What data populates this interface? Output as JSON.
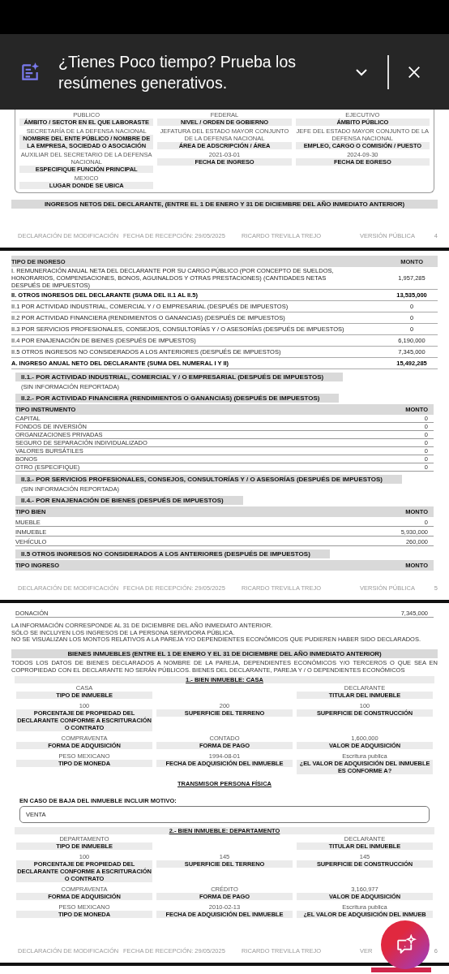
{
  "banner": {
    "text": "¿Tienes Poco tiempo? Prueba los resúmenes generativos."
  },
  "page_4": {
    "fields": [
      {
        "value": "PUBLICO",
        "label": "ÁMBITO / SECTOR EN EL QUE LABORASTE"
      },
      {
        "value": "FEDERAL",
        "label": "NIVEL / ORDEN DE GOBIERNO"
      },
      {
        "value": "EJECUTIVO",
        "label": "ÁMBITO PÚBLICO"
      },
      {
        "value": "SECRETARÍA DE LA DEFENSA NACIONAL",
        "label": "NOMBRE DEL ENTE PÚBLICO / NOMBRE DE LA EMPRESA, SOCIEDAD O ASOCIACIÓN"
      },
      {
        "value": "JEFATURA DEL ESTADO MAYOR CONJUNTO DE LA DEFENSA NACIONAL",
        "label": "ÁREA DE ADSCRIPCIÓN / ÁREA"
      },
      {
        "value": "JEFE DEL ESTADO MAYOR CONJUNTO DE LA DEFENSA NACIONAL",
        "label": "EMPLEO, CARGO O COMISIÓN / PUESTO"
      },
      {
        "value": "AUXILIAR DEL SECRETARIO DE LA DEFENSA NACIONAL",
        "label": "ESPECIFIQUE FUNCIÓN PRINCIPAL"
      },
      {
        "value": "2021-03-01",
        "label": "FECHA DE INGRESO"
      },
      {
        "value": "2024-09-30",
        "label": "FECHA DE EGRESO"
      },
      {
        "value": "MEXICO",
        "label": "LUGAR DONDE SE UBICA"
      }
    ],
    "heading": "INGRESOS NETOS DEL DECLARANTE, (ENTRE EL 1 DE ENERO Y 31 DE DICIEMBRE DEL AÑO INMEDIATO ANTERIOR)",
    "footer": {
      "doc_type": "DECLARACIÓN DE MODIFICACIÓN",
      "received": "FECHA DE RECEPCIÓN: 29/05/2025",
      "name": "RICARDO TREVILLA TREJO",
      "version": "VERSIÓN PÚBLICA",
      "page": "4"
    }
  },
  "page_5": {
    "income_table": {
      "columns": [
        "TIPO DE INGRESO",
        "MONTO"
      ],
      "rows": [
        {
          "label": "I. REMUNERACIÓN ANUAL NETA DEL DECLARANTE POR SU CARGO PÚBLICO (POR CONCEPTO DE SUELDOS, HONORARIOS, COMPENSACIONES, BONOS, AGUINALDOS Y OTRAS PRESTACIONES) (CANTIDADES NETAS DESPUÉS DE IMPUESTOS)",
          "amount": "1,957,285",
          "bold": false
        },
        {
          "label": "II. OTROS INGRESOS DEL DECLARANTE (SUMA DEL II.1 AL II.5)",
          "amount": "13,535,000",
          "bold": true
        },
        {
          "label": "II.1 POR ACTIVIDAD INDUSTRIAL, COMERCIAL Y / O EMPRESARIAL (DESPUÉS DE IMPUESTOS)",
          "amount": "0",
          "bold": false
        },
        {
          "label": "II.2 POR ACTIVIDAD FINANCIERA (RENDIMIENTOS O GANANCIAS) (DESPUÉS DE IMPUESTOS)",
          "amount": "0",
          "bold": false
        },
        {
          "label": "II.3 POR SERVICIOS PROFESIONALES, CONSEJOS, CONSULTORÍAS Y / O ASESORÍAS (DESPUÉS DE IMPUESTOS)",
          "amount": "0",
          "bold": false
        },
        {
          "label": "II.4 POR ENAJENACIÓN DE BIENES (DESPUÉS DE IMPUESTOS)",
          "amount": "6,190,000",
          "bold": false
        },
        {
          "label": "II.5 OTROS INGRESOS NO CONSIDERADOS A LOS ANTERIORES (DESPUÉS DE IMPUESTOS)",
          "amount": "7,345,000",
          "bold": false
        },
        {
          "label": "A. INGRESO ANUAL NETO DEL DECLARANTE (SUMA DEL NUMERAL I Y II)",
          "amount": "15,492,285",
          "bold": true
        }
      ]
    },
    "sections": [
      {
        "kind": "note",
        "heading": "II.1.- POR ACTIVIDAD INDUSTRIAL, COMERCIAL Y / O EMPRESARIAL (DESPUÉS DE IMPUESTOS)",
        "note": "(SIN INFORMACIÓN REPORTADA)"
      },
      {
        "kind": "table",
        "heading": "II.2.- POR ACTIVIDAD FINANCIERA (RENDIMIENTOS O GANANCIAS) (DESPUÉS DE IMPUESTOS)",
        "columns": [
          "TIPO INSTRUMENTO",
          "MONTO"
        ],
        "rows": [
          {
            "label": "CAPITAL",
            "amount": "0"
          },
          {
            "label": "FONDOS DE INVERSIÓN",
            "amount": "0"
          },
          {
            "label": "ORGANIZACIONES PRIVADAS",
            "amount": "0"
          },
          {
            "label": "SEGURO DE SEPARACIÓN INDIVIDUALIZADO",
            "amount": "0"
          },
          {
            "label": "VALORES BURSÁTILES",
            "amount": "0"
          },
          {
            "label": "BONOS",
            "amount": "0"
          },
          {
            "label": "OTRO (ESPECIFIQUE)",
            "amount": "0"
          }
        ]
      },
      {
        "kind": "note",
        "heading": "II.3.- POR SERVICIOS PROFESIONALES, CONSEJOS, CONSULTORÍAS Y / O ASESORÍAS (DESPUÉS DE IMPUESTOS)",
        "note": "(SIN INFORMACIÓN REPORTADA)"
      },
      {
        "kind": "table",
        "heading": "II.4.- POR ENAJENACIÓN DE BIENES (DESPUÉS DE IMPUESTOS)",
        "columns": [
          "TIPO BIEN",
          "MONTO"
        ],
        "rows": [
          {
            "label": "MUEBLE",
            "amount": "0"
          },
          {
            "label": "INMUEBLE",
            "amount": "5,930,000"
          },
          {
            "label": "VEHÍCULO",
            "amount": "260,000"
          }
        ]
      },
      {
        "kind": "table",
        "heading": "II.5 OTROS INGRESOS NO CONSIDERADOS A LOS ANTERIORES (DESPUÉS DE IMPUESTOS)",
        "columns": [
          "TIPO INGRESO",
          "MONTO"
        ]
      }
    ],
    "footer": {
      "doc_type": "DECLARACIÓN DE MODIFICACIÓN",
      "received": "FECHA DE RECEPCIÓN: 29/05/2025",
      "name": "RICARDO TREVILLA TREJO",
      "version": "VERSIÓN PÚBLICA",
      "page": "5"
    }
  },
  "page_6": {
    "continued_rows": [
      {
        "label": "DONACIÓN",
        "amount": "7,345,000"
      }
    ],
    "notes": [
      "LA INFORMACIÓN CORRESPONDE AL 31 DE DICIEMBRE DEL AÑO INMEDIATO ANTERIOR.",
      "SÓLO SE INCLUYEN LOS INGRESOS DE LA PERSONA SERVIDORA PÚBLICA.",
      "NO SE VISUALIZAN LOS MONTOS RELATIVOS A LA PAREJA Y/O DEPENDIENTES ECONÓMICOS QUE PUDIEREN HABER SIDO DECLARADOS."
    ],
    "heading": "BIENES INMUEBLES (ENTRE EL 1 DE ENERO Y EL 31 DE DICIEMBRE DEL AÑO INMEDIATO ANTERIOR)",
    "disclaimer": "TODOS LOS DATOS DE BIENES DECLARADOS A NOMBRE DE LA PAREJA, DEPENDIENTES ECONÓMICOS Y/O TERCEROS O QUE SEA EN COPROPIEDAD CON EL DECLARANTE NO SERÁN PÚBLICOS. BIENES DEL DECLARANTE, PAREJA Y / O DEPENDIENTES ECONÓMICOS",
    "properties": [
      {
        "title": "1.- BIEN INMUEBLE: CASA",
        "type": {
          "value": "CASA",
          "label": "TIPO DE INMUEBLE"
        },
        "owner": {
          "value": "DECLARANTE",
          "label": "TITULAR DEL INMUEBLE"
        },
        "details": [
          {
            "value": "100",
            "label": "PORCENTAJE DE PROPIEDAD DEL DECLARANTE CONFORME A ESCRITURACIÓN O CONTRATO"
          },
          {
            "value": "200",
            "label": "SUPERFICIE DEL TERRENO"
          },
          {
            "value": "100",
            "label": "SUPERFICIE DE CONSTRUCCIÓN"
          },
          {
            "value": "COMPRAVENTA",
            "label": "FORMA DE ADQUISICIÓN"
          },
          {
            "value": "CONTADO",
            "label": "FORMA DE PAGO"
          },
          {
            "value": "1,600,000",
            "label": "VALOR DE ADQUISICIÓN"
          },
          {
            "value": "PESO MEXICANO",
            "label": "TIPO DE MONEDA"
          },
          {
            "value": "1994-08-01",
            "label": "FECHA DE ADQUISICIÓN DEL INMUEBLE"
          },
          {
            "value": "Escritura publica",
            "label": "¿EL VALOR DE ADQUISICIÓN DEL INMUEBLE ES CONFORME A?"
          }
        ],
        "transferor": "TRANSMISOR PERSONA FÍSICA",
        "removal_label": "EN CASO DE BAJA DEL INMUEBLE INCLUIR MOTIVO:",
        "removal_reason": "VENTA"
      },
      {
        "title": "2.- BIEN INMUEBLE: DEPARTAMENTO",
        "type": {
          "value": "DEPARTAMENTO",
          "label": "TIPO DE INMUEBLE"
        },
        "owner": {
          "value": "DECLARANTE",
          "label": "TITULAR DEL INMUEBLE"
        },
        "details": [
          {
            "value": "100",
            "label": "PORCENTAJE DE PROPIEDAD DEL DECLARANTE CONFORME A ESCRITURACIÓN O CONTRATO"
          },
          {
            "value": "145",
            "label": "SUPERFICIE DEL TERRENO"
          },
          {
            "value": "145",
            "label": "SUPERFICIE DE CONSTRUCCIÓN"
          },
          {
            "value": "COMPRAVENTA",
            "label": "FORMA DE ADQUISICIÓN"
          },
          {
            "value": "CRÉDITO",
            "label": "FORMA DE PAGO"
          },
          {
            "value": "3,160,977",
            "label": "VALOR DE ADQUISICIÓN"
          },
          {
            "value": "PESO MEXICANO",
            "label": "TIPO DE MONEDA"
          },
          {
            "value": "2010-02-13",
            "label": "FECHA DE ADQUISICIÓN DEL INMUEBLE"
          },
          {
            "value": "Escritura publica",
            "label": "¿EL VALOR DE ADQUISICIÓN DEL INMUEB"
          }
        ]
      }
    ],
    "footer": {
      "doc_type": "DECLARACIÓN DE MODIFICACIÓN",
      "received": "FECHA DE RECEPCIÓN: 29/05/2025",
      "name": "RICARDO TREVILLA TREJO",
      "version": "VER",
      "page": "6"
    }
  }
}
